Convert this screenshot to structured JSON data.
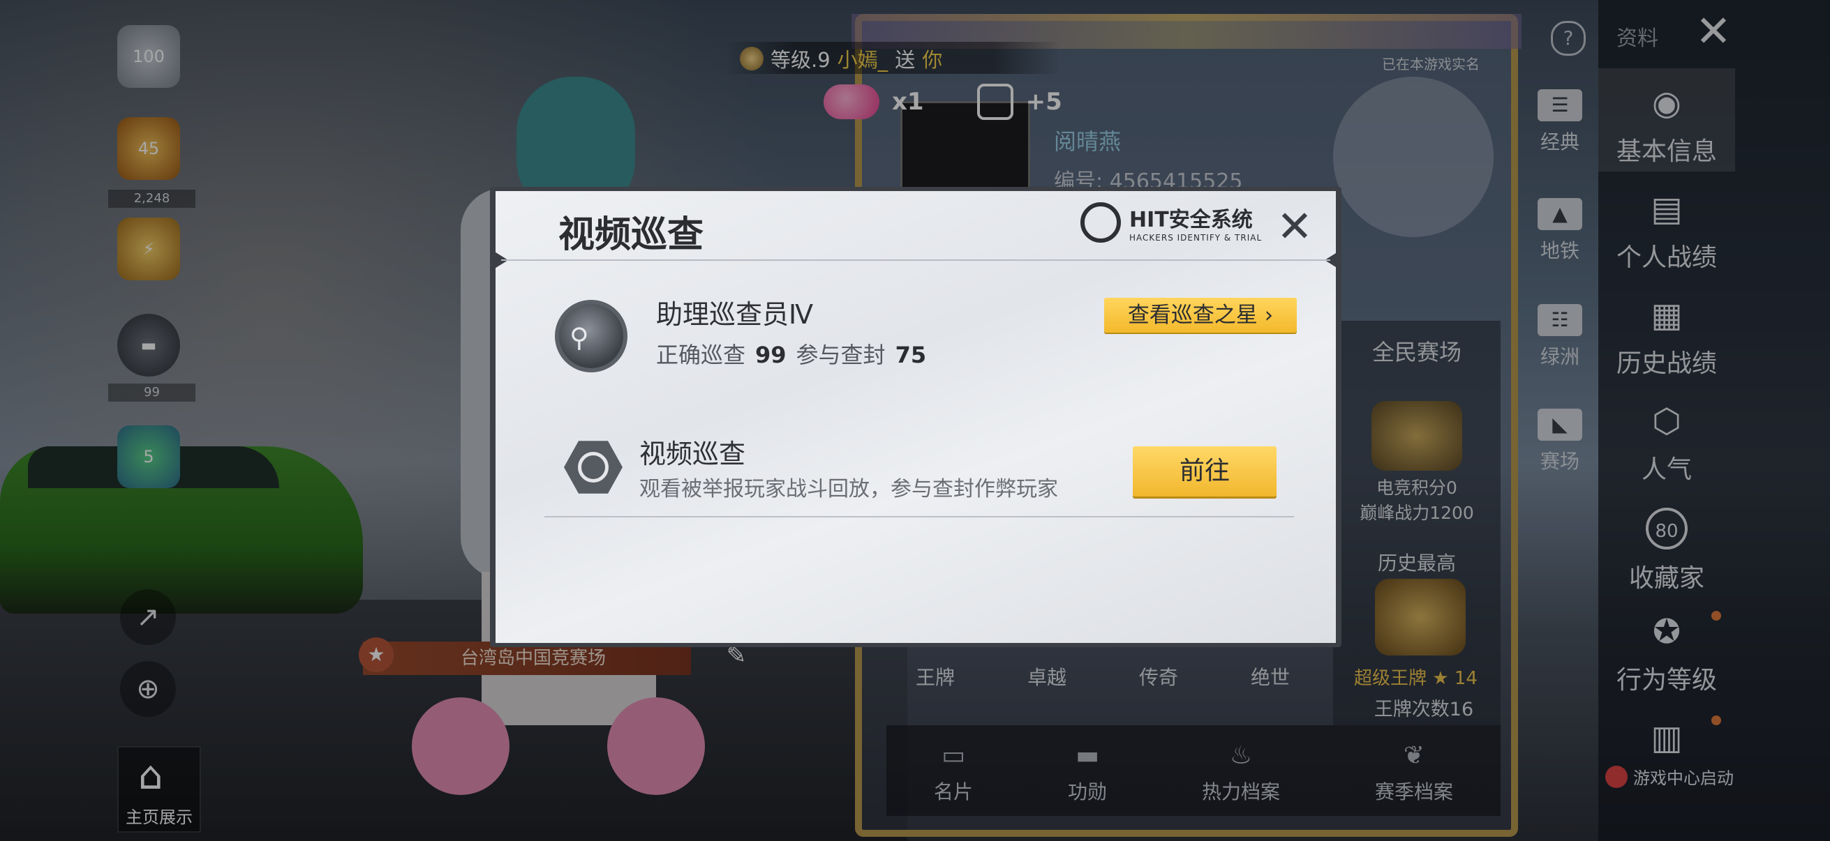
{
  "player": {
    "level_label": "等级.9",
    "gift_sender": "小嫣_",
    "gift_send": "送",
    "gift_to": "你",
    "gift_heart_count": "x1",
    "gift_popularity": "+5",
    "name": "阅晴燕",
    "id_line": "编号: 4565415525",
    "realname_note": "已在本游戏实名"
  },
  "left_column": {
    "level_badge": "100",
    "rank_badge_1": "45",
    "rank_label_1": "2,248",
    "rank_label_2": "99",
    "rank_badge_3": "5"
  },
  "map_tag": "台湾岛中国竞赛场",
  "home_display": "主页展示",
  "profile": {
    "panel_title": "全民赛场",
    "esports_points": "电竞积分0",
    "peak_power": "巅峰战力1200",
    "history_best": "历史最高",
    "ace_title": "超级王牌",
    "ace_stars": "14",
    "ace_count": "王牌次数16",
    "tiers": [
      "王牌",
      "卓越",
      "传奇",
      "绝世"
    ],
    "bottom_tabs": [
      "名片",
      "功勋",
      "热力档案",
      "赛季档案"
    ]
  },
  "mode_nav": [
    "经典",
    "地铁",
    "绿洲",
    "赛场"
  ],
  "right_nav": {
    "data_label": "资料",
    "items": [
      "基本信息",
      "个人战绩",
      "历史战绩",
      "人气",
      "收藏家",
      "行为等级"
    ],
    "collector_badge": "80",
    "game_center": "游戏中心启动"
  },
  "dialog": {
    "title": "视频巡查",
    "logo_main": "HIT安全系统",
    "logo_sub": "HACKERS IDENTIFY & TRIAL",
    "rank_name": "助理巡查员Ⅳ",
    "correct_label": "正确巡查",
    "correct_value": "99",
    "ban_label": "参与查封",
    "ban_value": "75",
    "star_button": "查看巡查之星 ›",
    "task_title": "视频巡查",
    "task_desc": "观看被举报玩家战斗回放，参与查封作弊玩家",
    "go_button": "前往"
  }
}
